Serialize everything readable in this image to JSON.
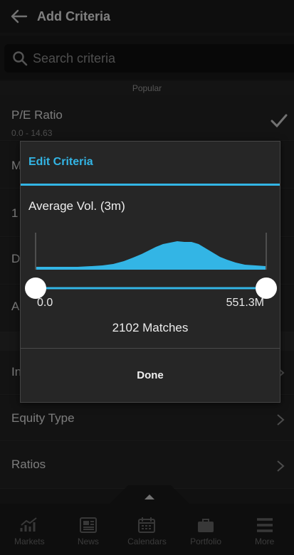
{
  "header": {
    "title": "Add Criteria"
  },
  "search": {
    "placeholder": "Search criteria"
  },
  "section": {
    "label": "Popular"
  },
  "rows": [
    {
      "label": "P/E Ratio",
      "sub": "0.0 - 14.63"
    },
    {
      "label": "M"
    },
    {
      "label": "1"
    },
    {
      "label": "D"
    },
    {
      "label": "A"
    },
    {
      "label": "In"
    },
    {
      "label": "Equity Type"
    },
    {
      "label": "Ratios"
    }
  ],
  "nav": [
    {
      "label": "Markets",
      "icon": "markets-icon"
    },
    {
      "label": "News",
      "icon": "news-icon"
    },
    {
      "label": "Calendars",
      "icon": "calendar-icon"
    },
    {
      "label": "Portfolio",
      "icon": "portfolio-icon"
    },
    {
      "label": "More",
      "icon": "menu-icon"
    }
  ],
  "dialog": {
    "title": "Edit Criteria",
    "metric": "Average Vol. (3m)",
    "range_min_label": "0.0",
    "range_max_label": "551.3M",
    "selected_range_fraction": [
      0,
      1
    ],
    "matches": "2102 Matches",
    "done_label": "Done"
  },
  "colors": {
    "accent": "#33b5e5",
    "background": "#1f1f1f"
  }
}
